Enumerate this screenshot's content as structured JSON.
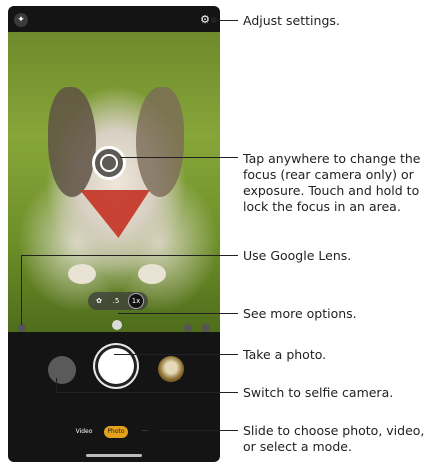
{
  "annotations": {
    "settings": "Adjust settings.",
    "focus": "Tap anywhere to change the focus (rear camera only) or exposure. Touch and hold to lock the focus in an area.",
    "lens": "Use Google Lens.",
    "more_options": "See more options.",
    "take_photo": "Take a photo.",
    "selfie": "Switch to selfie camera.",
    "modes": "Slide to choose photo, video, or select a mode."
  },
  "camera": {
    "zoom": {
      "macro_icon": "macro-flower-icon",
      "half": ".5",
      "one": "1x",
      "selected": "1x"
    },
    "modes": {
      "video": "Video",
      "photo": "Photo",
      "more": "···",
      "selected": "Photo"
    },
    "icons": {
      "top_left": "sparkle-icon",
      "top_right": "gear-icon"
    }
  },
  "colors": {
    "accent": "#e3a21a",
    "annotation_text": "#222222"
  }
}
